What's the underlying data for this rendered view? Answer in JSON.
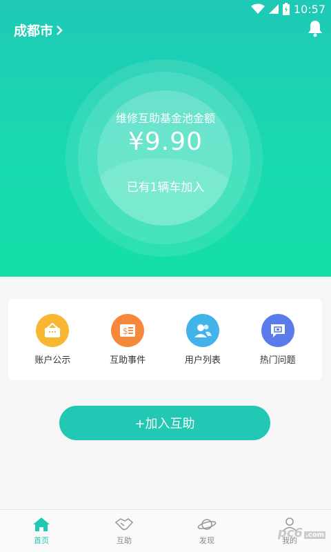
{
  "status_bar": {
    "time": "10:57"
  },
  "header": {
    "city": "成都市"
  },
  "fund": {
    "label": "维修互助基金池金额",
    "amount": "¥9.90",
    "cars_joined": "已有1辆车加入"
  },
  "quick_actions": [
    {
      "label": "账户公示",
      "icon": "account-shop-icon",
      "color": "#f7b733"
    },
    {
      "label": "互助事件",
      "icon": "event-ticket-icon",
      "color": "#f6883b"
    },
    {
      "label": "用户列表",
      "icon": "users-icon",
      "color": "#3fb3ea"
    },
    {
      "label": "热门问题",
      "icon": "question-chat-icon",
      "color": "#5a7bea"
    }
  ],
  "join_button": {
    "label": "+加入互助"
  },
  "tabs": [
    {
      "label": "首页",
      "icon": "home-icon",
      "active": true
    },
    {
      "label": "互助",
      "icon": "handshake-icon",
      "active": false
    },
    {
      "label": "发现",
      "icon": "planet-icon",
      "active": false
    },
    {
      "label": "我的",
      "icon": "profile-icon",
      "active": false
    }
  ],
  "watermark": {
    "text": "pc6",
    "sub": ".com"
  },
  "colors": {
    "primary": "#1ec9b6",
    "button": "#22c8b3"
  }
}
